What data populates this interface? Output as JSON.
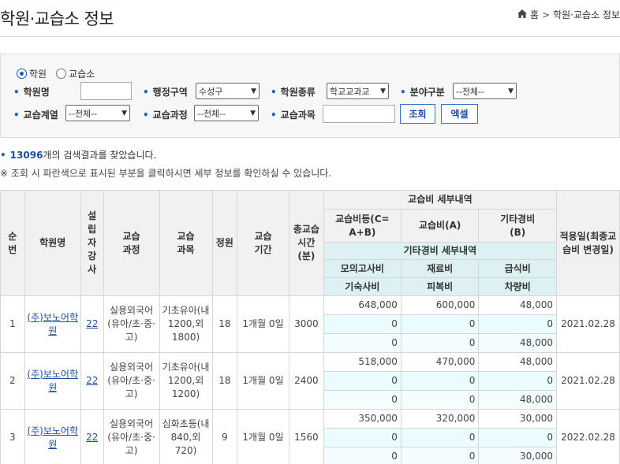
{
  "page": {
    "title": "학원·교습소 정보",
    "breadcrumb": {
      "home": "홈",
      "current": "학원·교습소 정보"
    }
  },
  "search": {
    "radios": [
      {
        "label": "학원",
        "checked": true
      },
      {
        "label": "교습소",
        "checked": false
      }
    ],
    "labels": {
      "academy_name": "학원명",
      "district": "행정구역",
      "academy_type": "학원종류",
      "field": "분야구분",
      "line": "교습계열",
      "course": "교습과정",
      "subject": "교습과목"
    },
    "values": {
      "academy_name": "",
      "district": "수성구",
      "academy_type": "학교교과교",
      "field": "--전체--",
      "line": "--전체--",
      "course": "--전체--",
      "subject": ""
    },
    "buttons": {
      "search": "조회",
      "excel": "엑셀"
    }
  },
  "results": {
    "count": "13096",
    "count_suffix": "개의 검색결과를 찾았습니다.",
    "note": "※ 조회 시 파란색으로 표시된 부분을 클릭하시면 세부 정보를 확인하실 수 있습니다."
  },
  "table": {
    "headers": {
      "no": "순번",
      "name": "학원명",
      "founder": "설립자강사",
      "course": "교습과정",
      "subject": "교습과목",
      "capacity": "정원",
      "period": "교습기간",
      "total_time": "총교습시간(분)",
      "fee_detail": "교습비 세부내역",
      "fee_total": "교습비등(C=A+B)",
      "fee_a": "교습비(A)",
      "other_b": "기타경비(B)",
      "applied": "적용일(최종교습비 변경일)",
      "other_detail": "기타경비 세부내역",
      "mock": "모의고사비",
      "material": "재료비",
      "meal": "급식비",
      "dorm": "기숙사비",
      "uniform": "피복비",
      "vehicle": "차량비"
    },
    "rows": [
      {
        "no": "1",
        "name": "(주)보노어학원",
        "founder": "22",
        "course": "실용외국어(유아/초·중·고)",
        "subject": "기초유아(내1200,외1800)",
        "capacity": "18",
        "period": "1개월 0일",
        "total_time": "3000",
        "fee_total": "648,000",
        "fee_a": "600,000",
        "other_b": "48,000",
        "mock": "0",
        "material": "0",
        "meal": "0",
        "dorm": "0",
        "uniform": "0",
        "vehicle": "48,000",
        "applied": "2021.02.28"
      },
      {
        "no": "2",
        "name": "(주)보노어학원",
        "founder": "22",
        "course": "실용외국어(유아/초·중·고)",
        "subject": "기초유아(내1200,외1200)",
        "capacity": "18",
        "period": "1개월 0일",
        "total_time": "2400",
        "fee_total": "518,000",
        "fee_a": "470,000",
        "other_b": "48,000",
        "mock": "0",
        "material": "0",
        "meal": "0",
        "dorm": "0",
        "uniform": "0",
        "vehicle": "48,000",
        "applied": "2021.02.28"
      },
      {
        "no": "3",
        "name": "(주)보노어학원",
        "founder": "22",
        "course": "실용외국어(유아/초·중·고)",
        "subject": "심화초등(내840,외720)",
        "capacity": "9",
        "period": "1개월 0일",
        "total_time": "1560",
        "fee_total": "350,000",
        "fee_a": "320,000",
        "other_b": "30,000",
        "mock": "0",
        "material": "0",
        "meal": "0",
        "dorm": "0",
        "uniform": "0",
        "vehicle": "30,000",
        "applied": "2022.02.28"
      }
    ]
  }
}
